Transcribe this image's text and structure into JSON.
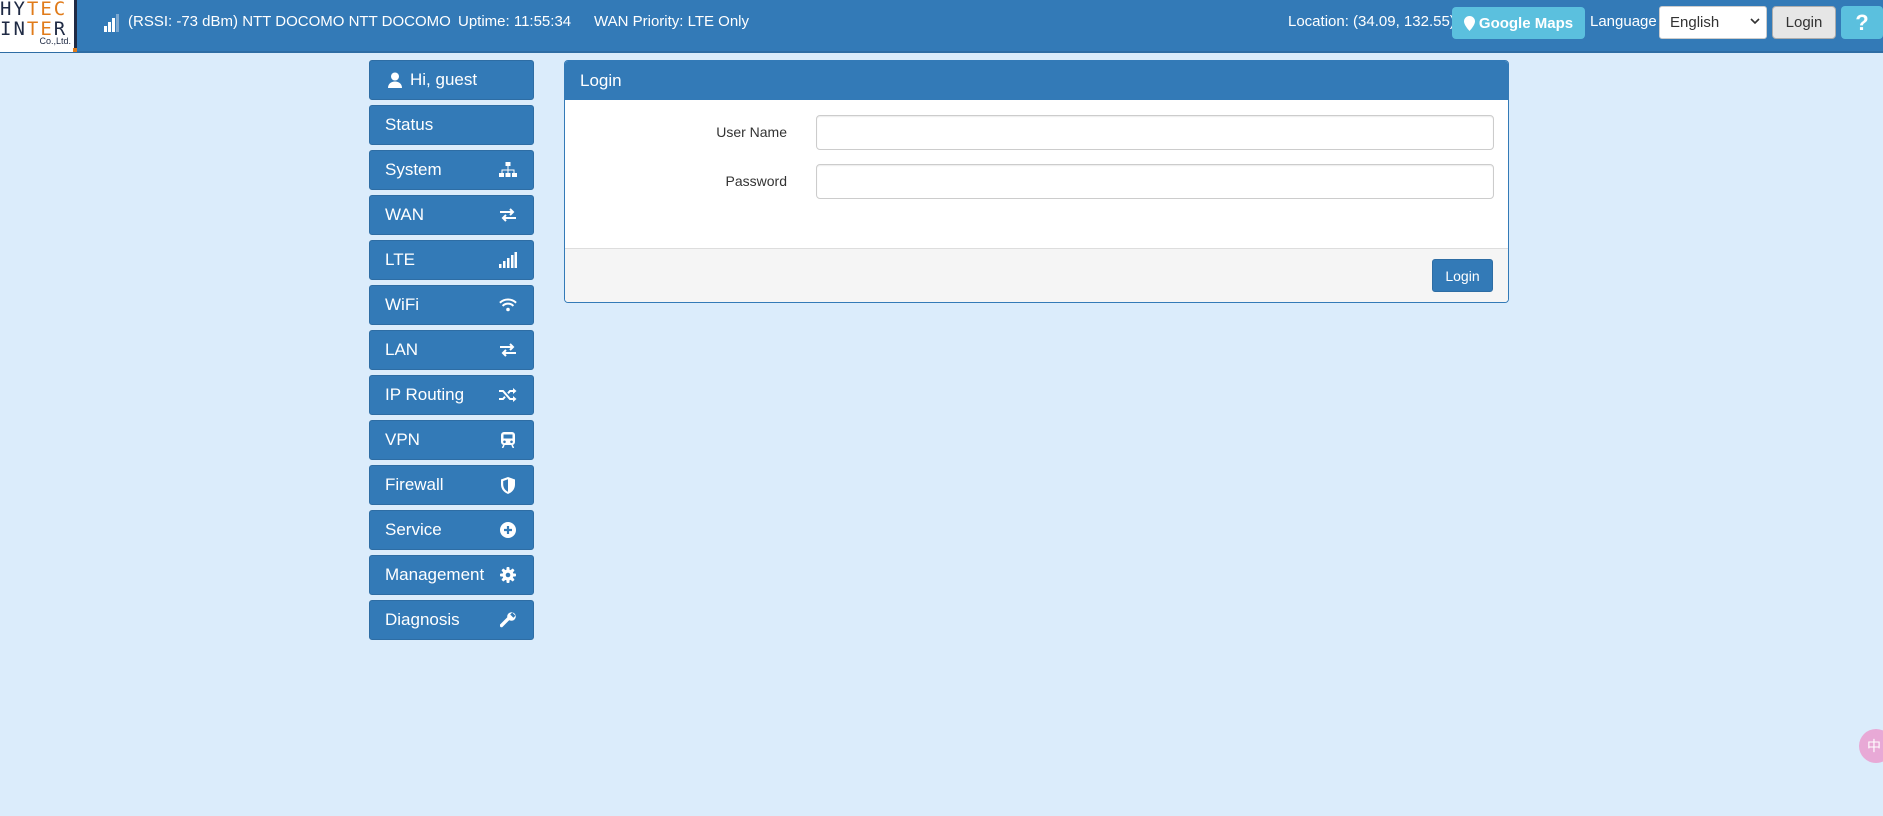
{
  "header": {
    "logo": {
      "line1_dark": "HY",
      "line1_accent": "TEC",
      "line2_dark_a": "IN",
      "line2_accent": "TE",
      "line2_dark_b": "R",
      "company": "Co.,Ltd."
    },
    "signal_text": "(RSSI: -73 dBm) NTT DOCOMO NTT DOCOMO",
    "uptime": "Uptime: 11:55:34",
    "wan_priority": "WAN Priority: LTE Only",
    "location": "Location: (34.09, 132.55)",
    "maps_label": "Google Maps",
    "language_label": "Language",
    "language_value": "English",
    "login_label": "Login",
    "help_label": "?"
  },
  "sidebar": {
    "greeting": "Hi, guest",
    "items": [
      {
        "label": "Status",
        "icon": "none"
      },
      {
        "label": "System",
        "icon": "sitemap-icon"
      },
      {
        "label": "WAN",
        "icon": "exchange-icon"
      },
      {
        "label": "LTE",
        "icon": "signal-bars-icon"
      },
      {
        "label": "WiFi",
        "icon": "wifi-icon"
      },
      {
        "label": "LAN",
        "icon": "exchange-icon"
      },
      {
        "label": "IP Routing",
        "icon": "random-icon"
      },
      {
        "label": "VPN",
        "icon": "train-icon"
      },
      {
        "label": "Firewall",
        "icon": "shield-icon"
      },
      {
        "label": "Service",
        "icon": "plus-circle-icon"
      },
      {
        "label": "Management",
        "icon": "gear-icon"
      },
      {
        "label": "Diagnosis",
        "icon": "wrench-icon"
      }
    ]
  },
  "login_panel": {
    "title": "Login",
    "username_label": "User Name",
    "username_value": "",
    "password_label": "Password",
    "password_value": "",
    "submit_label": "Login"
  },
  "floating_badge": "中",
  "colors": {
    "primary": "#337ab7",
    "info": "#5bc0de",
    "background": "#dbecfb"
  }
}
